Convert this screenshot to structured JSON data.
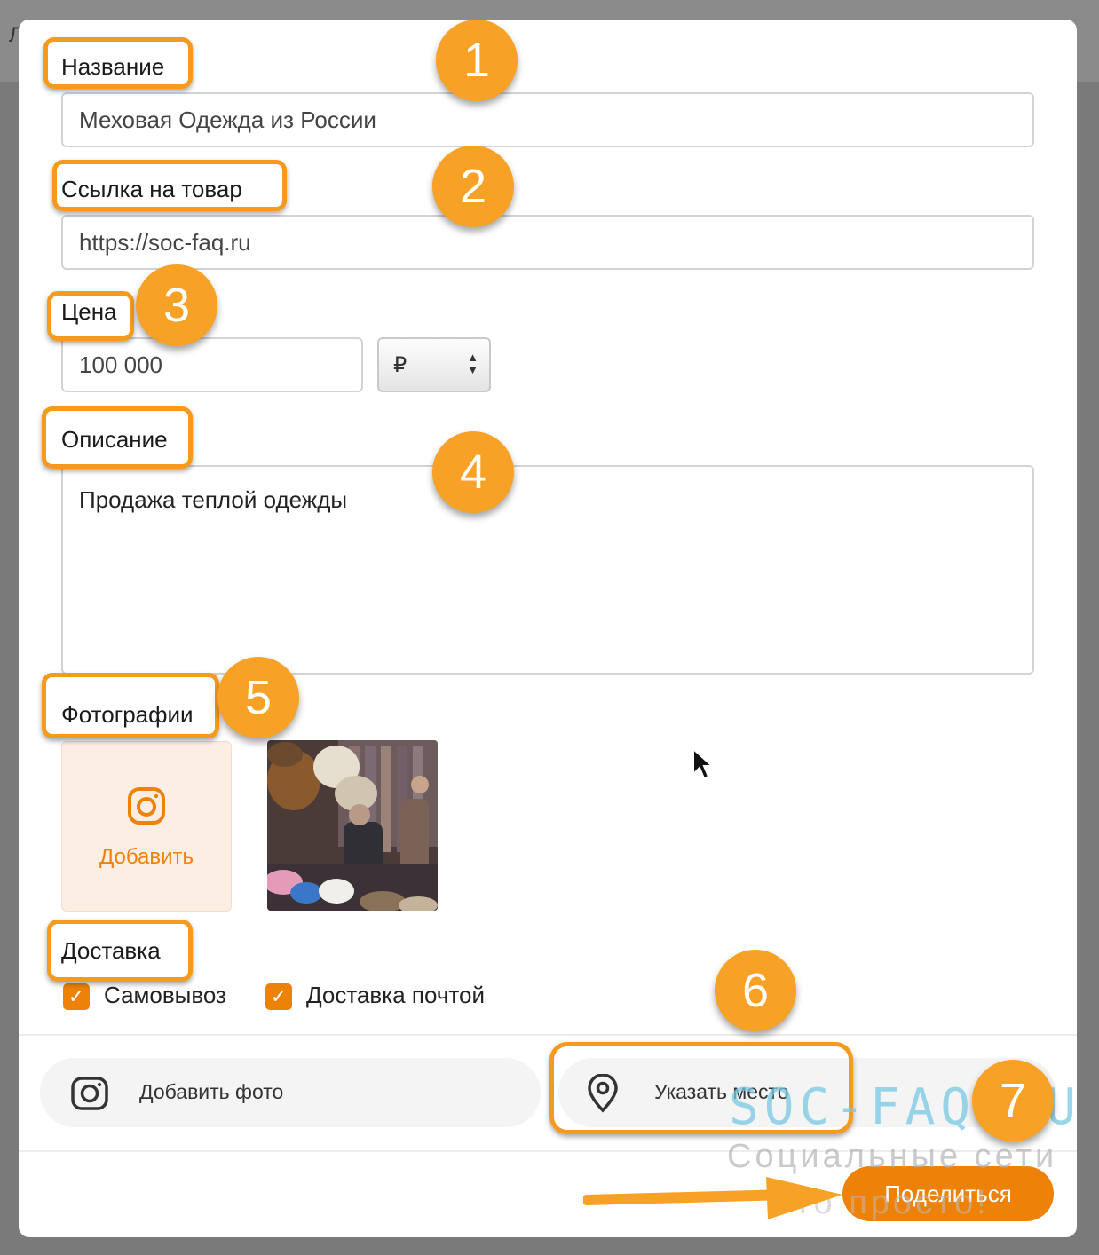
{
  "backdrop": {
    "edge_letter": "Л"
  },
  "form": {
    "name": {
      "label": "Название",
      "value": "Меховая Одежда из России"
    },
    "link": {
      "label": "Ссылка на товар",
      "value": "https://soc-faq.ru"
    },
    "price": {
      "label": "Цена",
      "value": "100 000",
      "currency": "₽"
    },
    "description": {
      "label": "Описание",
      "value": "Продажа теплой одежды"
    },
    "photos": {
      "label": "Фотографии",
      "add_label": "Добавить"
    },
    "delivery": {
      "label": "Доставка",
      "options": [
        {
          "label": "Самовывоз",
          "checked": true
        },
        {
          "label": "Доставка почтой",
          "checked": true
        }
      ]
    }
  },
  "footer": {
    "add_photo_label": "Добавить фото",
    "location_label": "Указать место",
    "share_label": "Поделиться"
  },
  "annotations": {
    "steps": [
      "1",
      "2",
      "3",
      "4",
      "5",
      "6",
      "7"
    ]
  },
  "watermark": {
    "site": "SOC-FAQ.RU",
    "tagline_line1": "Социальные сети",
    "tagline_line2": "это просто!"
  },
  "colors": {
    "accent": "#ee8208",
    "annotation": "#f7a126",
    "photo_tile_bg": "#fdeee4"
  }
}
